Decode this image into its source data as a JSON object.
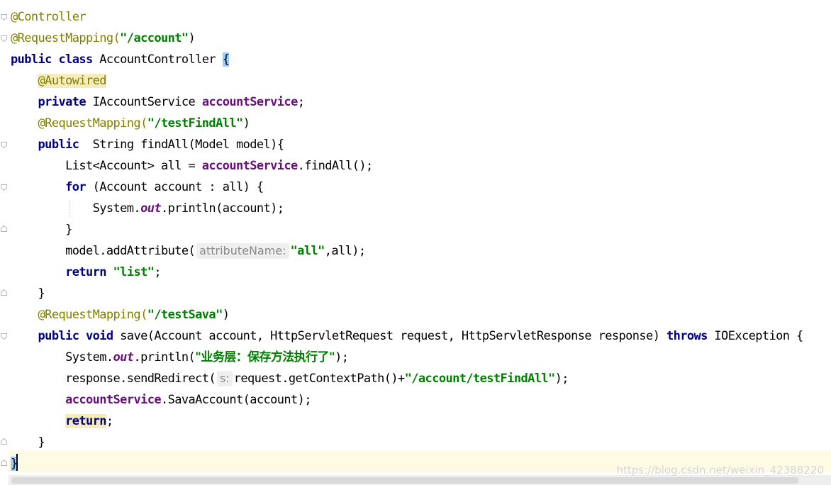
{
  "editor": {
    "lines": [
      {
        "segments": [
          {
            "t": "@Controller",
            "c": "ann"
          }
        ]
      },
      {
        "segments": [
          {
            "t": "@RequestMapping(",
            "c": "ann"
          },
          {
            "t": "\"/account\"",
            "c": "str"
          },
          {
            "t": ")",
            "c": ""
          }
        ]
      },
      {
        "segments": [
          {
            "t": "public class ",
            "c": "kw"
          },
          {
            "t": "AccountController ",
            "c": ""
          },
          {
            "t": "{",
            "c": "brace"
          }
        ]
      },
      {
        "segments": [
          {
            "t": "    ",
            "c": ""
          },
          {
            "t": "@Autowired",
            "c": "ann hl"
          }
        ]
      },
      {
        "segments": [
          {
            "t": "    ",
            "c": ""
          },
          {
            "t": "private ",
            "c": "kw"
          },
          {
            "t": "IAccountService ",
            "c": ""
          },
          {
            "t": "accountService",
            "c": "fld"
          },
          {
            "t": ";",
            "c": ""
          }
        ]
      },
      {
        "segments": [
          {
            "t": "    ",
            "c": ""
          },
          {
            "t": "@RequestMapping(",
            "c": "ann"
          },
          {
            "t": "\"/testFindAll\"",
            "c": "str"
          },
          {
            "t": ")",
            "c": ""
          }
        ]
      },
      {
        "segments": [
          {
            "t": "    ",
            "c": ""
          },
          {
            "t": "public  ",
            "c": "kw"
          },
          {
            "t": "String findAll(Model model){",
            "c": ""
          }
        ]
      },
      {
        "segments": [
          {
            "t": "        List<Account> all = ",
            "c": ""
          },
          {
            "t": "accountService",
            "c": "fld"
          },
          {
            "t": ".findAll();",
            "c": ""
          }
        ]
      },
      {
        "segments": [
          {
            "t": "        ",
            "c": ""
          },
          {
            "t": "for ",
            "c": "kw"
          },
          {
            "t": "(Account account : all) {",
            "c": ""
          }
        ]
      },
      {
        "segments": [
          {
            "t": "            System.",
            "c": ""
          },
          {
            "t": "out",
            "c": "sfld"
          },
          {
            "t": ".println(account);",
            "c": ""
          }
        ]
      },
      {
        "segments": [
          {
            "t": "        }",
            "c": ""
          }
        ]
      },
      {
        "segments": [
          {
            "t": "        model.addAttribute(",
            "c": ""
          },
          {
            "t": "attributeName:",
            "c": "hint"
          },
          {
            "t": "\"all\"",
            "c": "str"
          },
          {
            "t": ",all);",
            "c": ""
          }
        ]
      },
      {
        "segments": [
          {
            "t": "        ",
            "c": ""
          },
          {
            "t": "return ",
            "c": "kw"
          },
          {
            "t": "\"list\"",
            "c": "str"
          },
          {
            "t": ";",
            "c": ""
          }
        ]
      },
      {
        "segments": [
          {
            "t": "    }",
            "c": ""
          }
        ]
      },
      {
        "segments": [
          {
            "t": "    ",
            "c": ""
          },
          {
            "t": "@RequestMapping(",
            "c": "ann"
          },
          {
            "t": "\"/testSava\"",
            "c": "str"
          },
          {
            "t": ")",
            "c": ""
          }
        ]
      },
      {
        "segments": [
          {
            "t": "    ",
            "c": ""
          },
          {
            "t": "public void ",
            "c": "kw"
          },
          {
            "t": "save(Account account, HttpServletRequest request, HttpServletResponse response) ",
            "c": ""
          },
          {
            "t": "throws ",
            "c": "kw"
          },
          {
            "t": "IOException {",
            "c": ""
          }
        ]
      },
      {
        "segments": [
          {
            "t": "        System.",
            "c": ""
          },
          {
            "t": "out",
            "c": "sfld"
          },
          {
            "t": ".println(",
            "c": ""
          },
          {
            "t": "\"业务层：保存方法执行了\"",
            "c": "str cjk"
          },
          {
            "t": ");",
            "c": ""
          }
        ]
      },
      {
        "segments": [
          {
            "t": "        response.sendRedirect(",
            "c": ""
          },
          {
            "t": "s:",
            "c": "hint"
          },
          {
            "t": "request.getContextPath()+",
            "c": ""
          },
          {
            "t": "\"/account/testFindAll\"",
            "c": "str"
          },
          {
            "t": ");",
            "c": ""
          }
        ]
      },
      {
        "segments": [
          {
            "t": "        ",
            "c": ""
          },
          {
            "t": "accountService",
            "c": "fld"
          },
          {
            "t": ".SavaAccount(account);",
            "c": ""
          }
        ]
      },
      {
        "segments": [
          {
            "t": "        ",
            "c": ""
          },
          {
            "t": "return",
            "c": "kw hl"
          },
          {
            "t": ";",
            "c": ""
          }
        ]
      },
      {
        "segments": [
          {
            "t": "    }",
            "c": ""
          }
        ]
      },
      {
        "segments": [
          {
            "t": "}",
            "c": "brace"
          }
        ]
      }
    ],
    "fold_markers": [
      "start",
      "start",
      "",
      "",
      "",
      "",
      "start",
      "",
      "start",
      "",
      "end",
      "",
      "",
      "end",
      "",
      "start",
      "",
      "",
      "",
      "",
      "end",
      "end"
    ]
  },
  "watermark": "https://blog.csdn.net/weixin_42388220"
}
